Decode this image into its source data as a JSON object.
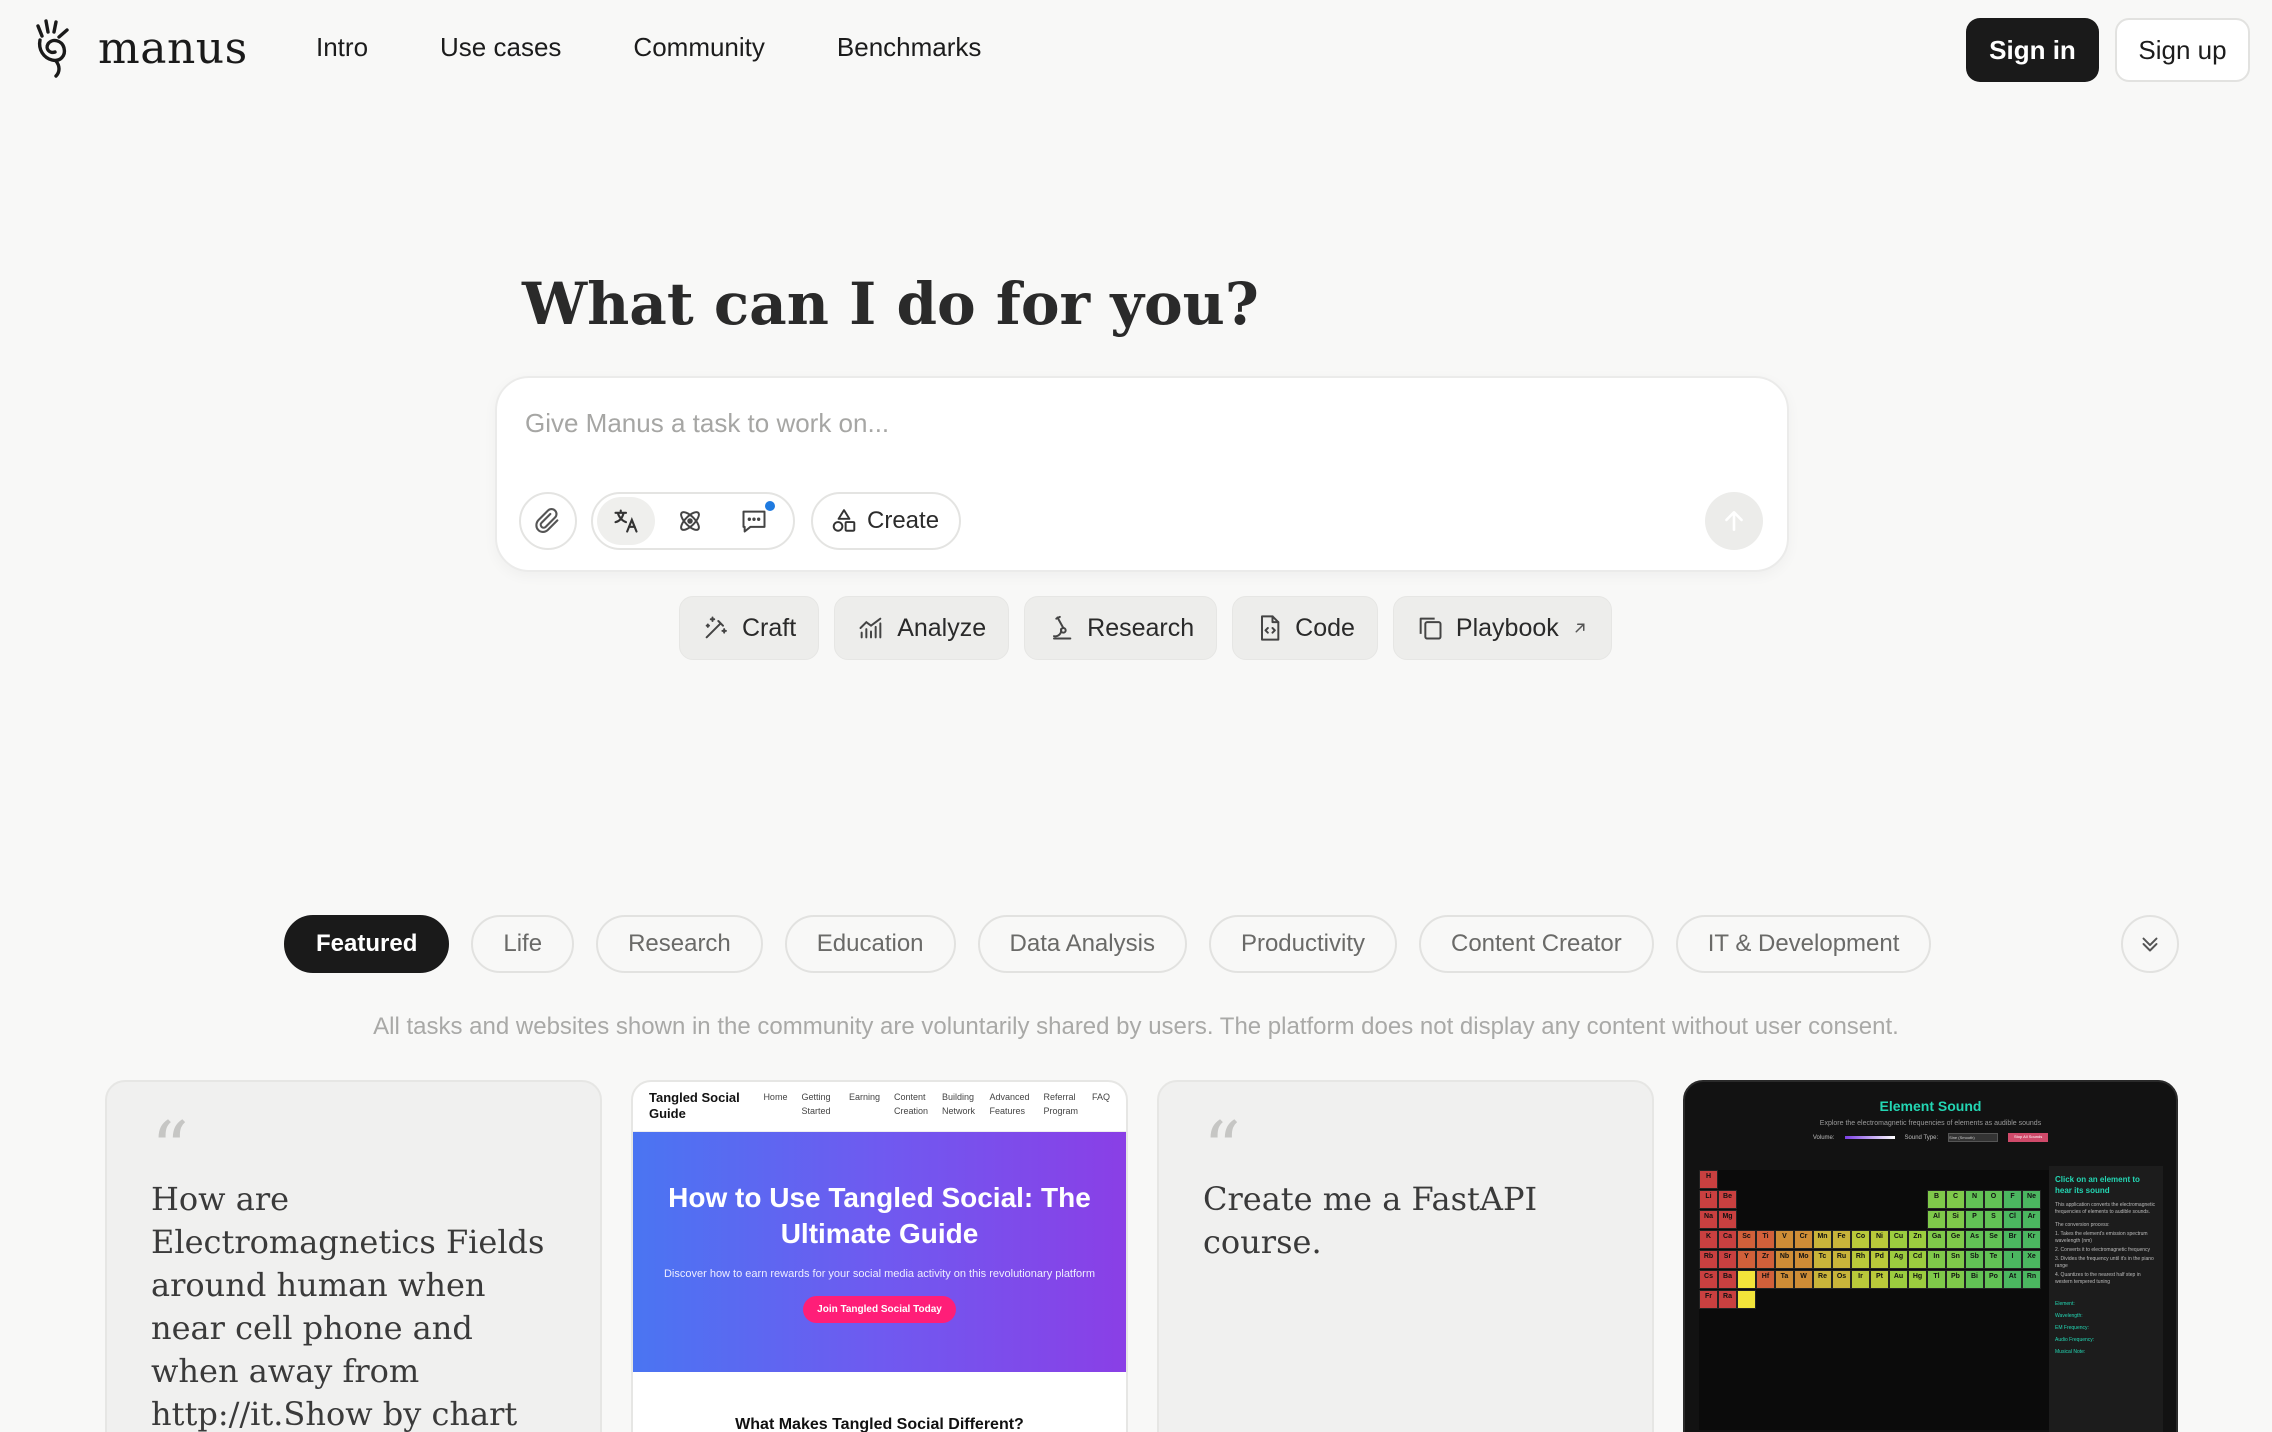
{
  "header": {
    "brand": "manus",
    "nav": [
      "Intro",
      "Use cases",
      "Community",
      "Benchmarks"
    ],
    "sign_in": "Sign in",
    "sign_up": "Sign up"
  },
  "hero": {
    "title": "What can I do for you?",
    "placeholder": "Give Manus a task to work on...",
    "create_label": "Create"
  },
  "quick_actions": [
    "Craft",
    "Analyze",
    "Research",
    "Code",
    "Playbook"
  ],
  "categories": {
    "items": [
      "Featured",
      "Life",
      "Research",
      "Education",
      "Data Analysis",
      "Productivity",
      "Content Creator",
      "IT & Development"
    ],
    "active": "Featured"
  },
  "disclaimer": "All tasks and websites shown in the community are voluntarily shared by users. The platform does not display any content without user consent.",
  "cards": {
    "quote1": "How are Electromagnetics Fields around human when near cell phone and when away from http://it.Show by chart",
    "site": {
      "brand": "Tangled Social Guide",
      "links": [
        "Home",
        "Getting Started",
        "Earning",
        "Content Creation",
        "Building Network",
        "Advanced Features",
        "Referral Program",
        "FAQ"
      ],
      "hero_title": "How to Use Tangled Social: The Ultimate Guide",
      "hero_sub": "Discover how to earn rewards for your social media activity on this revolutionary platform",
      "cta": "Join Tangled Social Today",
      "section": "What Makes Tangled Social Different?"
    },
    "quote2": "Create me a FastAPI course.",
    "element_sound": {
      "title": "Element Sound",
      "subtitle": "Explore the electromagnetic frequencies of elements as audible sounds",
      "volume": "Volume:",
      "sound_type": "Sound Type:",
      "sound_select": "Sine (Smooth)",
      "stop_btn": "Stop All Sounds",
      "panel_title": "Click on an element to hear its sound",
      "panel_text": "This application converts the electromagnetic frequencies of elements to audible sounds.",
      "panel_process_title": "The conversion process:",
      "panel_steps": [
        "1. Takes the element's emission spectrum wavelength (nm)",
        "2. Converts it to electromagnetic frequency",
        "3. Divides the frequency until it's in the piano range",
        "4. Quantizes to the nearest half step in western tempered tuning"
      ],
      "fields": [
        "Element:",
        "Wavelength:",
        "EM Frequency:",
        "Audio Frequency:",
        "Musical Note:"
      ],
      "symbols": [
        "H",
        "He",
        "Li",
        "Be",
        "B",
        "C",
        "N",
        "O",
        "F",
        "Ne",
        "Na",
        "Mg",
        "Al",
        "Si",
        "P",
        "S",
        "Cl",
        "Ar",
        "K",
        "Ca",
        "Sc",
        "Ti",
        "V",
        "Cr",
        "Mn",
        "Fe",
        "Co",
        "Ni",
        "Cu",
        "Zn",
        "Ga",
        "Ge",
        "As",
        "Se",
        "Br",
        "Kr",
        "Rb",
        "Sr",
        "Y",
        "Zr",
        "Nb",
        "Mo",
        "Tc",
        "Ru",
        "Rh",
        "Pd",
        "Ag",
        "Cd",
        "In",
        "Sn",
        "Sb",
        "Te",
        "I",
        "Xe",
        "Cs",
        "Ba",
        "",
        "Hf",
        "Ta",
        "W",
        "Re",
        "Os",
        "Ir",
        "Pt",
        "Au",
        "Hg",
        "Tl",
        "Pb",
        "Bi",
        "Po",
        "At",
        "Rn",
        "Fr",
        "Ra"
      ]
    }
  },
  "colors": {
    "background": "#f8f8f7",
    "primary": "#1a1a1a",
    "accent_blue": "#1f7ae0",
    "teal": "#23d6b3",
    "pink_cta": "#ff1e78"
  },
  "icons": {
    "logo": "manus-hand-icon",
    "attach": "paperclip-icon",
    "modes": [
      "translate-icon",
      "atom-icon",
      "chat-icon"
    ],
    "create": "shapes-icon",
    "send": "arrow-up-icon",
    "quick": [
      "magic-wand-icon",
      "chart-icon",
      "microscope-icon",
      "code-file-icon",
      "copy-icon"
    ],
    "playbook_external": "external-arrow-icon",
    "more": "chevron-down-icon"
  }
}
